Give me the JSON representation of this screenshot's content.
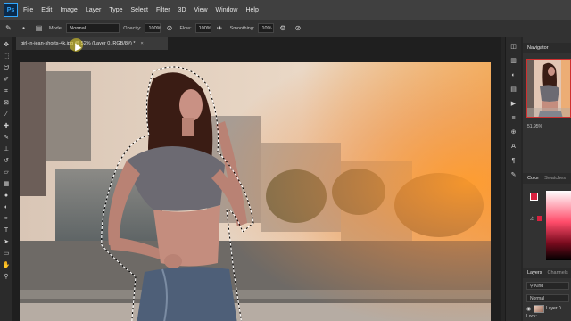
{
  "app": {
    "logo": "Ps"
  },
  "menu": [
    "File",
    "Edit",
    "Image",
    "Layer",
    "Type",
    "Select",
    "Filter",
    "3D",
    "View",
    "Window",
    "Help"
  ],
  "options": {
    "mode_label": "Mode:",
    "mode_value": "Normal",
    "opacity_label": "Opacity:",
    "opacity_value": "100%",
    "flow_label": "Flow:",
    "flow_value": "100%",
    "smoothing_label": "Smoothing:",
    "smoothing_value": "10%"
  },
  "document": {
    "tab_title": "girl-in-jean-shorts-4k.jpg @ 52% (Layer 0, RGB/8#) *",
    "close": "×"
  },
  "panels": {
    "navigator_tab": "Navigator",
    "zoom": "51.95%",
    "color_tab": "Color",
    "swatches_tab": "Swatches",
    "foreground_color": "#d9213f",
    "background_color": "#e8e8e8",
    "layers_tab": "Layers",
    "channels_tab": "Channels",
    "kind_filter": "Kind",
    "blend_mode": "Normal",
    "lock_label": "Lock:",
    "layer_name": "Layer 0"
  },
  "tools": [
    "move-tool",
    "marquee-tool",
    "lasso-tool",
    "quick-selection-tool",
    "crop-tool",
    "frame-tool",
    "eyedropper-tool",
    "healing-brush-tool",
    "brush-tool",
    "clone-stamp-tool",
    "history-brush-tool",
    "eraser-tool",
    "gradient-tool",
    "blur-tool",
    "dodge-tool",
    "pen-tool",
    "type-tool",
    "path-selection-tool",
    "rectangle-tool",
    "hand-tool",
    "zoom-tool"
  ]
}
